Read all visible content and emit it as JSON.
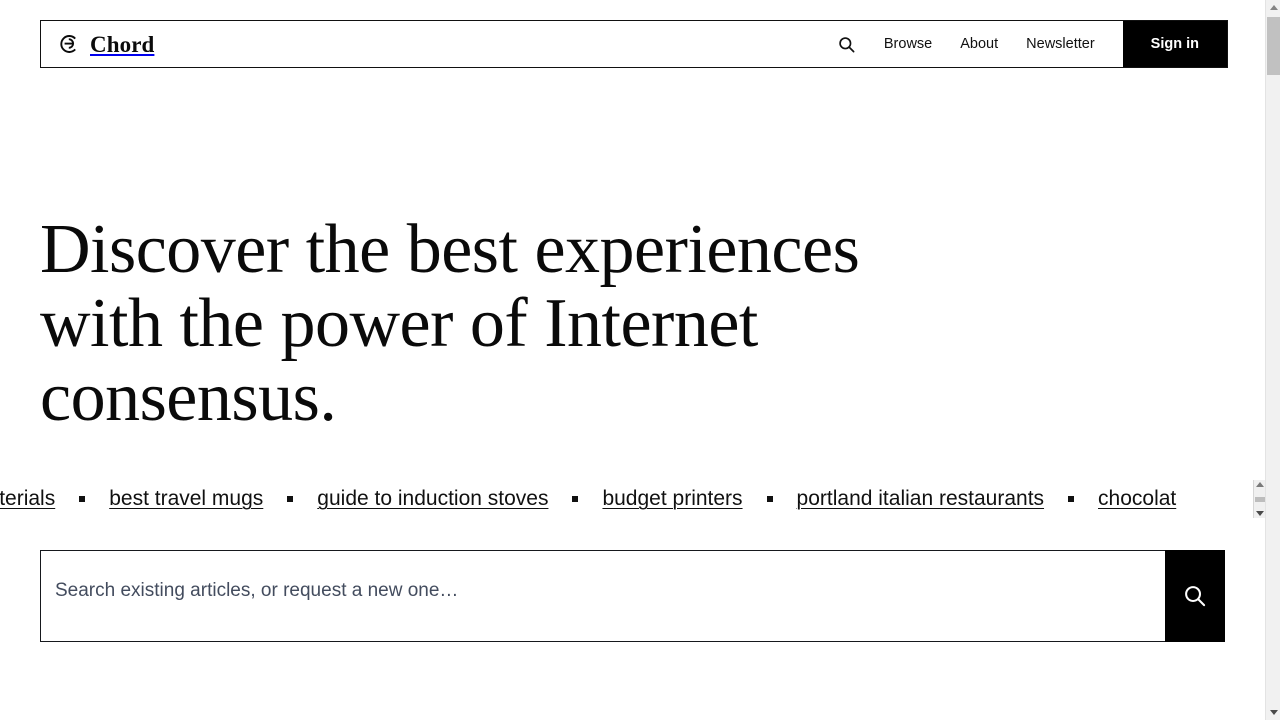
{
  "header": {
    "brand_name": "Chord",
    "brand_icon": "chord-logo-icon",
    "search_icon": "search-icon",
    "nav_links": [
      {
        "label": "Browse"
      },
      {
        "label": "About"
      },
      {
        "label": "Newsletter"
      }
    ],
    "signin_label": "Sign in"
  },
  "hero": {
    "title": "Discover the best experiences\nwith the power of Internet\nconsensus."
  },
  "tags": {
    "separator_icon": "square-bullet-icon",
    "items": [
      {
        "label": "eet materials"
      },
      {
        "label": "best travel mugs"
      },
      {
        "label": "guide to induction stoves"
      },
      {
        "label": "budget printers"
      },
      {
        "label": "portland italian restaurants"
      },
      {
        "label": "chocolat"
      }
    ]
  },
  "search": {
    "placeholder": "Search existing articles, or request a new one…",
    "value": "",
    "submit_icon": "search-icon"
  },
  "scrollbar": {
    "up_icon": "caret-up-icon",
    "down_icon": "caret-down-icon",
    "thumb": "scroll-thumb"
  },
  "colors": {
    "accent": "#000000",
    "text": "#111111",
    "placeholder": "#434c5e",
    "background": "#ffffff"
  }
}
